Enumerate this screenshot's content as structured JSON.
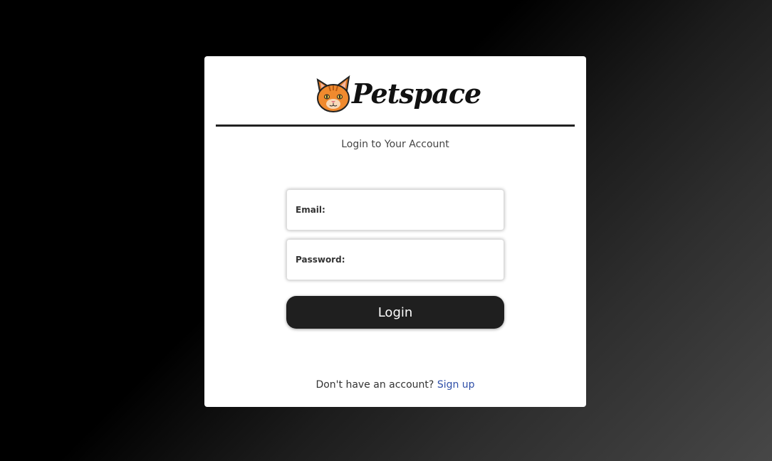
{
  "brand": {
    "name": "Petspace"
  },
  "login": {
    "subtitle": "Login to Your Account",
    "email_label": "Email:",
    "password_label": "Password:",
    "email_value": "",
    "password_value": "",
    "submit_label": "Login"
  },
  "signup": {
    "prompt": "Don't have an account?",
    "link_label": "Sign up"
  },
  "colors": {
    "button_bg": "#1f1f1f",
    "link": "#2f4fa8",
    "logo_cat": "#f08a2e"
  },
  "icons": {
    "logo_icon": "cat-face-icon"
  }
}
